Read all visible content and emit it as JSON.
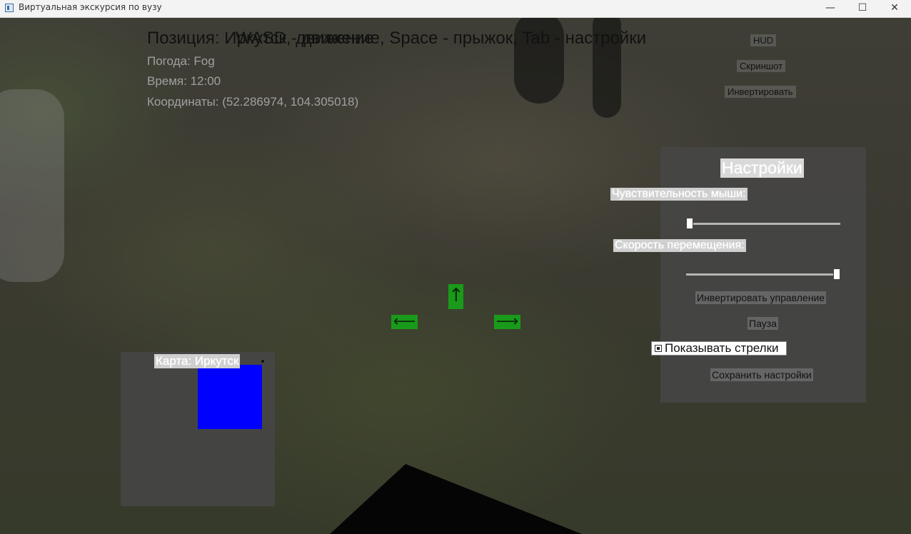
{
  "window": {
    "title": "Виртуальная экскурсия по вузу",
    "minimize_glyph": "—",
    "maximize_glyph": "☐",
    "close_glyph": "✕"
  },
  "hud": {
    "overlay_line_a": "Позиция: Иркутск, движение",
    "overlay_line_b": "WASD - движение, Space - прыжок, Tab - настройки",
    "weather": "Погода: Fog",
    "time": "Время: 12:00",
    "coords": "Координаты: (52.286974, 104.305018)",
    "hud_button": "HUD",
    "screenshot_button": "Скриншот",
    "invert_button": "Инвертировать"
  },
  "settings": {
    "title": "Настройки",
    "mouse_sensitivity_label": "Чувствительность мыши:",
    "mouse_sensitivity_value": 0.0,
    "move_speed_label": "Скорость перемещения:",
    "move_speed_value": 1.0,
    "invert_controls_button": "Инвертировать управление",
    "pause_button": "Пауза",
    "show_arrows_label": "Показывать стрелки",
    "show_arrows_checked": true,
    "save_button": "Сохранить настройки"
  },
  "arrows": {
    "up": "↑",
    "left": "⟵",
    "right": "⟶",
    "color": "#1a9a1a"
  },
  "minimap": {
    "label": "Карта: Иркутск",
    "marker_color": "#0000ff"
  }
}
